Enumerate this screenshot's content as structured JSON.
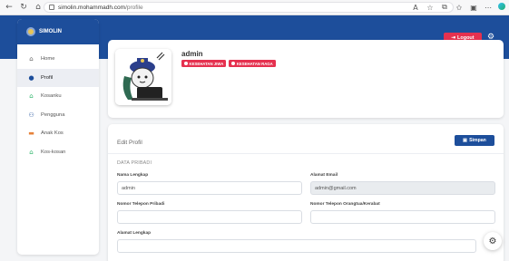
{
  "browser": {
    "url_host": "simolin.mohammadh.com",
    "url_path": "/profile"
  },
  "brand": {
    "name": "SIMOLIN"
  },
  "header": {
    "logout_label": "Logout"
  },
  "sidebar": {
    "items": [
      {
        "label": "Home",
        "icon": "home-icon"
      },
      {
        "label": "Profil",
        "icon": "user-icon",
        "active": true
      },
      {
        "label": "Kosanku",
        "icon": "house-icon"
      },
      {
        "label": "Pengguna",
        "icon": "users-icon"
      },
      {
        "label": "Anak Kos",
        "icon": "id-card-icon"
      },
      {
        "label": "Kos-kosan",
        "icon": "house-icon"
      }
    ]
  },
  "profile": {
    "name": "admin",
    "badges": [
      "KESEHATAN JIWA",
      "KESEHATAN RAGA"
    ]
  },
  "edit": {
    "title": "Edit Profil",
    "save_label": "Simpan",
    "section": "DATA PRIBADI",
    "fields": {
      "full_name": {
        "label": "Nama Lengkap",
        "value": "admin"
      },
      "email": {
        "label": "Alamat Email",
        "value": "admin@gmail.com"
      },
      "phone": {
        "label": "Nomor Telepon Pribadi",
        "value": ""
      },
      "parent_phone": {
        "label": "Nomor Telepon Orangtua/Kerabat",
        "value": ""
      },
      "address": {
        "label": "Alamat Lengkap",
        "value": ""
      }
    }
  },
  "colors": {
    "primary": "#1d4e9b",
    "danger": "#e5314f"
  }
}
